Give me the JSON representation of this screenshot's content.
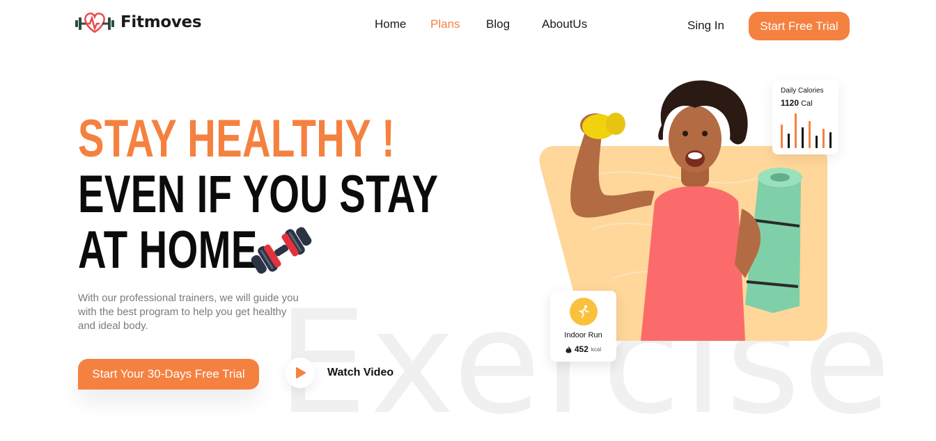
{
  "brand": {
    "name": "Fitmoves"
  },
  "nav": {
    "items": [
      {
        "label": "Home",
        "active": false
      },
      {
        "label": "Plans",
        "active": true
      },
      {
        "label": "Blog",
        "active": false
      },
      {
        "label": "AboutUs",
        "active": false
      }
    ],
    "signin_label": "Sing In",
    "trial_button_label": "Start Free Trial"
  },
  "hero": {
    "line1": "STAY HEALTHY !",
    "line2": "EVEN IF YOU STAY",
    "line3": "AT HOME",
    "description": "With our professional trainers, we will guide you with the best program to help you get healthy and ideal body.",
    "cta_label": "Start Your 30-Days Free Trial",
    "watch_label": "Watch Video",
    "background_word": "Exercise"
  },
  "calories_card": {
    "title": "Daily Calories",
    "value": "1120",
    "unit": "Cal",
    "bars": [
      {
        "level": 0.62,
        "color": "#f58140"
      },
      {
        "level": 0.38,
        "color": "#111111"
      },
      {
        "level": 0.9,
        "color": "#f58140"
      },
      {
        "level": 0.55,
        "color": "#111111"
      },
      {
        "level": 0.7,
        "color": "#f58140"
      },
      {
        "level": 0.32,
        "color": "#111111"
      },
      {
        "level": 0.5,
        "color": "#f58140"
      },
      {
        "level": 0.42,
        "color": "#111111"
      }
    ]
  },
  "run_card": {
    "label": "Indoor Run",
    "value": "452",
    "unit": "kcal"
  },
  "colors": {
    "accent": "#f58140",
    "hero_bg": "#ffd79a",
    "run_icon_bg": "#fbc13e"
  },
  "icons": {
    "logo": "heart-dumbbell-icon",
    "play": "play-icon",
    "run": "runner-icon",
    "fire": "flame-icon",
    "decor": "dumbbell-icon"
  }
}
